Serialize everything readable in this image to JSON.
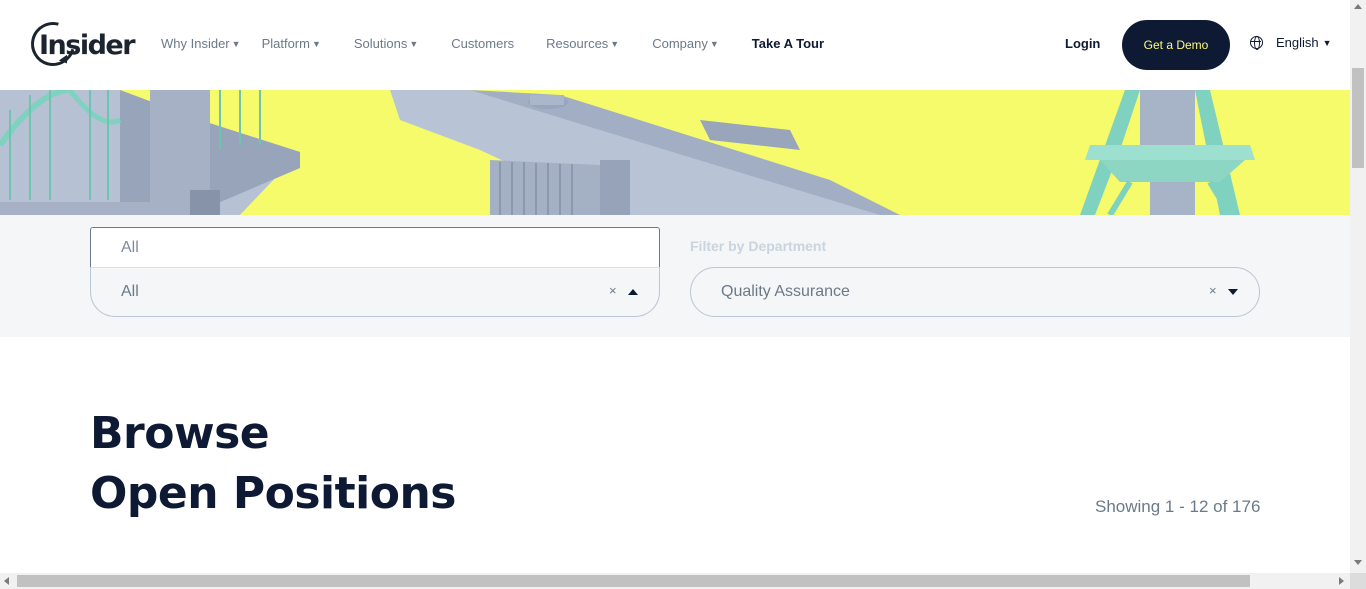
{
  "header": {
    "logo_text": "Insider",
    "nav": [
      {
        "label": "Why Insider",
        "has_caret": true
      },
      {
        "label": "Platform",
        "has_caret": true
      },
      {
        "label": "Solutions",
        "has_caret": true
      },
      {
        "label": "Customers",
        "has_caret": false
      },
      {
        "label": "Resources",
        "has_caret": true
      },
      {
        "label": "Company",
        "has_caret": true
      },
      {
        "label": "Take A Tour",
        "has_caret": false
      }
    ],
    "login_label": "Login",
    "demo_label": "Get a Demo",
    "language_label": "English",
    "caret_glyph": "▼"
  },
  "filters": {
    "location": {
      "search_value": "All",
      "selected_value": "All",
      "clear_glyph": "×"
    },
    "department": {
      "label": "Filter by Department",
      "selected_value": "Quality Assurance",
      "clear_glyph": "×"
    }
  },
  "main": {
    "title_line1": "Browse",
    "title_line2": "Open Positions",
    "showing_text": "Showing 1 - 12 of 176"
  },
  "colors": {
    "brand_dark": "#0e1a33",
    "hero_yellow": "#f5fb6a",
    "demo_text": "#fffb7a",
    "muted_text": "#6b7a89"
  },
  "icons": {
    "globe": "globe-icon",
    "caret": "caret-down-icon",
    "clear": "clear-icon",
    "arrow_up": "arrow-up-icon",
    "arrow_down": "arrow-down-icon"
  }
}
